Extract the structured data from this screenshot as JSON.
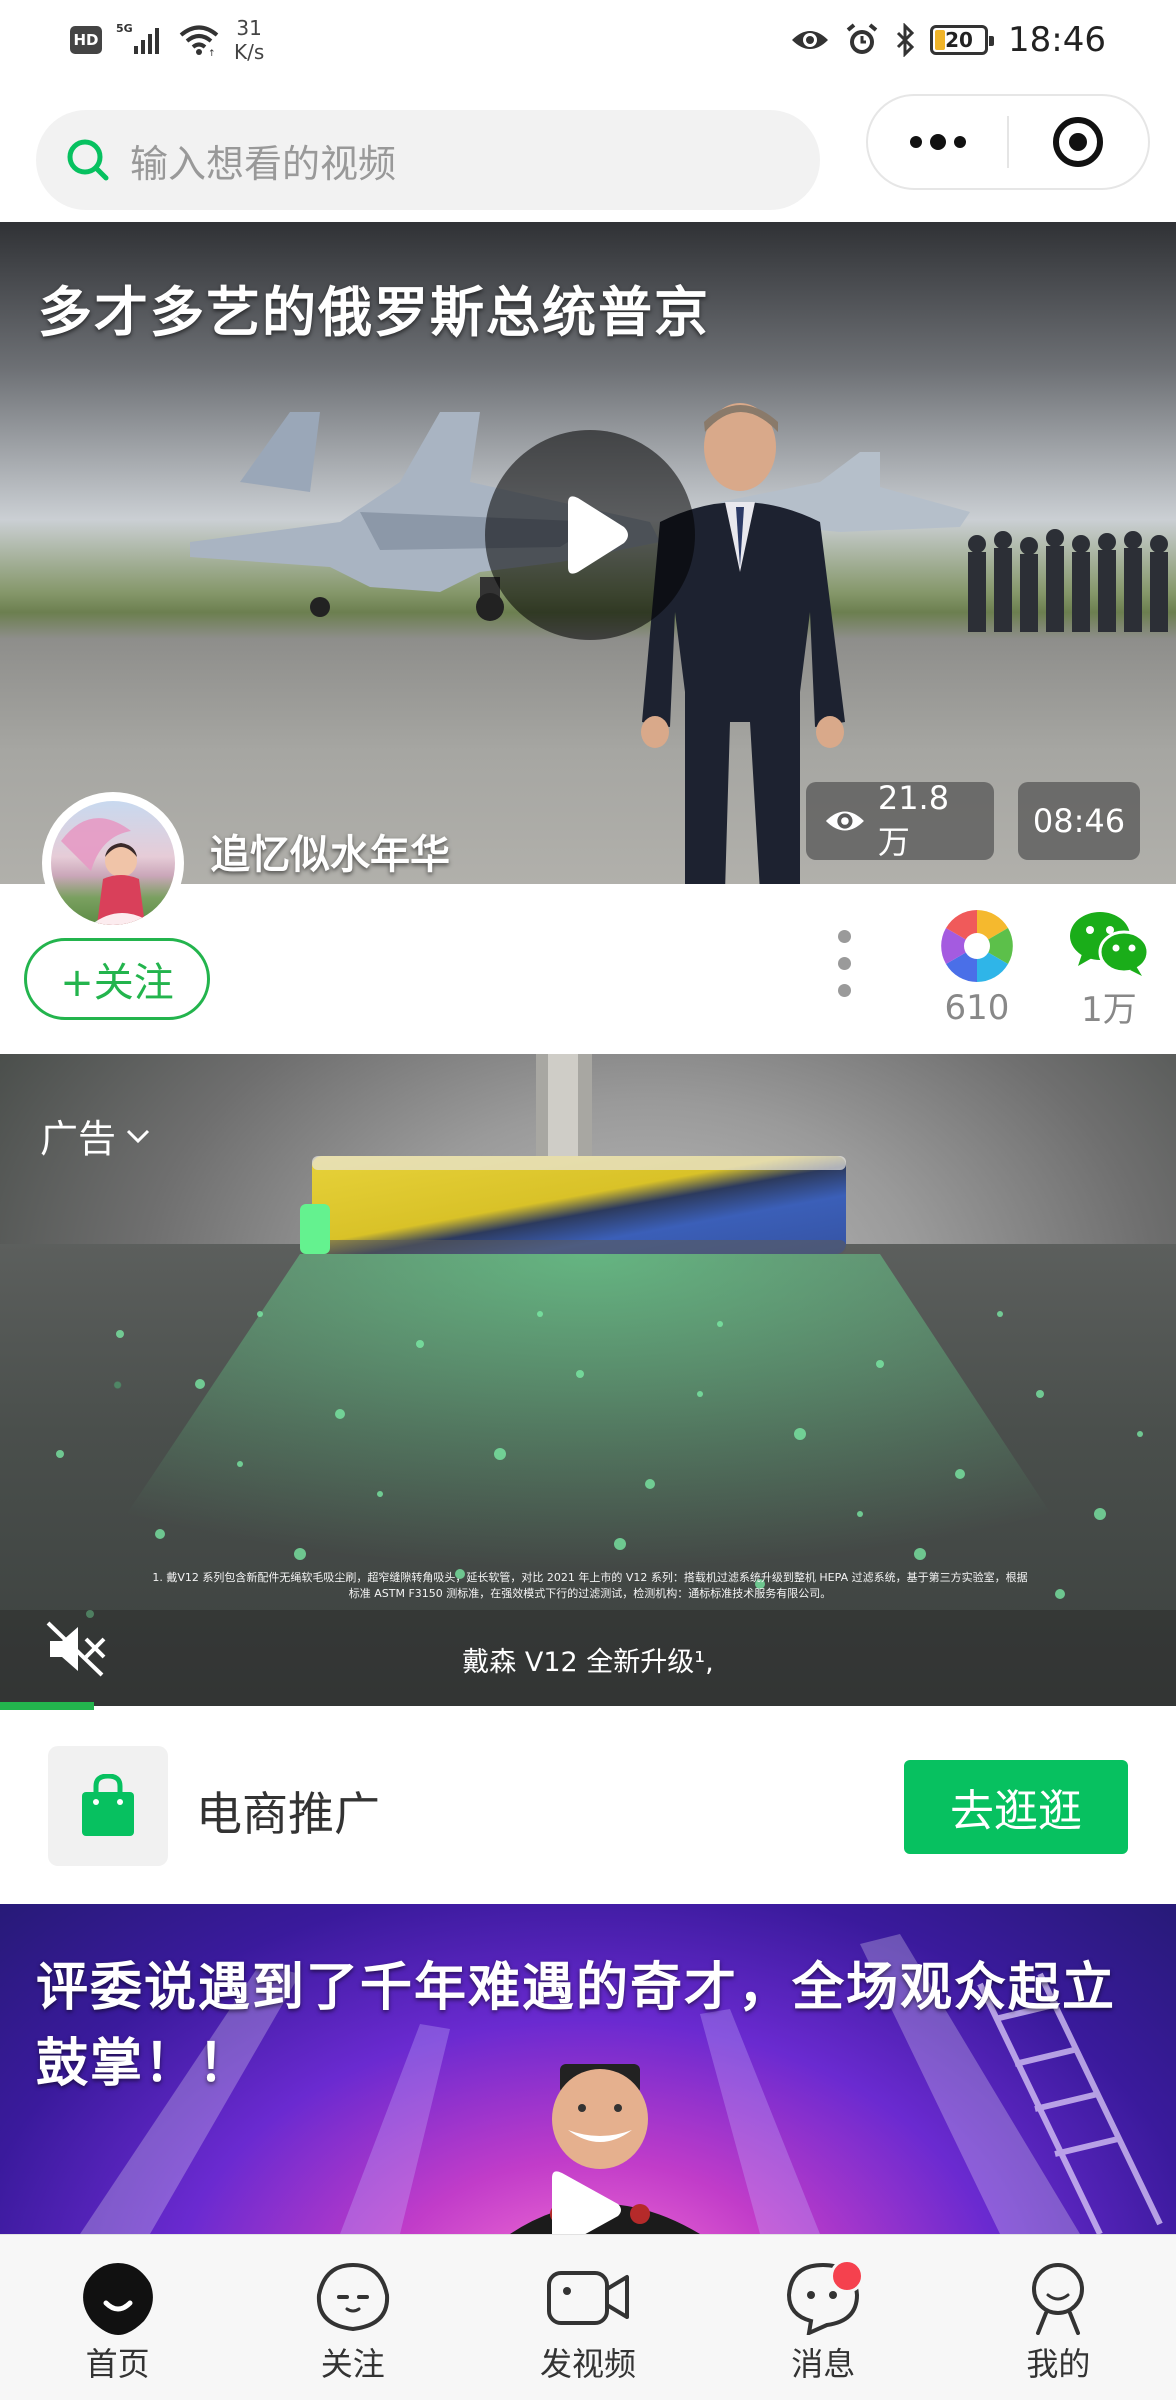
{
  "status_bar": {
    "hd": "HD",
    "network": "5G",
    "speed_value": "31",
    "speed_unit": "K/s",
    "battery": "20",
    "time": "18:46"
  },
  "search": {
    "placeholder": "输入想看的视频",
    "icon": "search-icon"
  },
  "capsule": {
    "more_icon": "more-dots-icon",
    "close_icon": "target-circle-icon"
  },
  "video1": {
    "title": "多才多艺的俄罗斯总统普京",
    "views": "21.8万",
    "duration": "08:46",
    "author": "追忆似水年华",
    "follow_label": "+关注",
    "moments_count": "610",
    "wechat_count": "1万"
  },
  "ad": {
    "label": "广告",
    "fine_print": "1. 戴V12 系列包含新配件无绳软毛吸尘刷，超窄缝隙转角吸头，延长软管，对比 2021 年上市的 V12 系列：搭载机过滤系统升级到整机 HEPA 过滤系统，基于第三方实验室，根据标准 ASTM F3150 测标准，在强效模式下行的过滤测试，检测机构：通标标准技术服务有限公司。",
    "caption": "戴森 V12 全新升级¹,",
    "progress_fraction": 0.08
  },
  "shop": {
    "title": "电商推广",
    "button": "去逛逛"
  },
  "video2": {
    "title": "评委说遇到了千年难遇的奇才，全场观众起立鼓掌！！"
  },
  "tabs": [
    {
      "label": "首页",
      "icon": "home-icon",
      "active": true
    },
    {
      "label": "关注",
      "icon": "follow-face-icon",
      "active": false
    },
    {
      "label": "发视频",
      "icon": "video-camera-icon",
      "active": false
    },
    {
      "label": "消息",
      "icon": "message-icon",
      "active": false,
      "badge": true
    },
    {
      "label": "我的",
      "icon": "profile-icon",
      "active": false
    }
  ],
  "colors": {
    "brand_green": "#07c160",
    "follow_green": "#23b44d",
    "badge_red": "#f5414e"
  }
}
